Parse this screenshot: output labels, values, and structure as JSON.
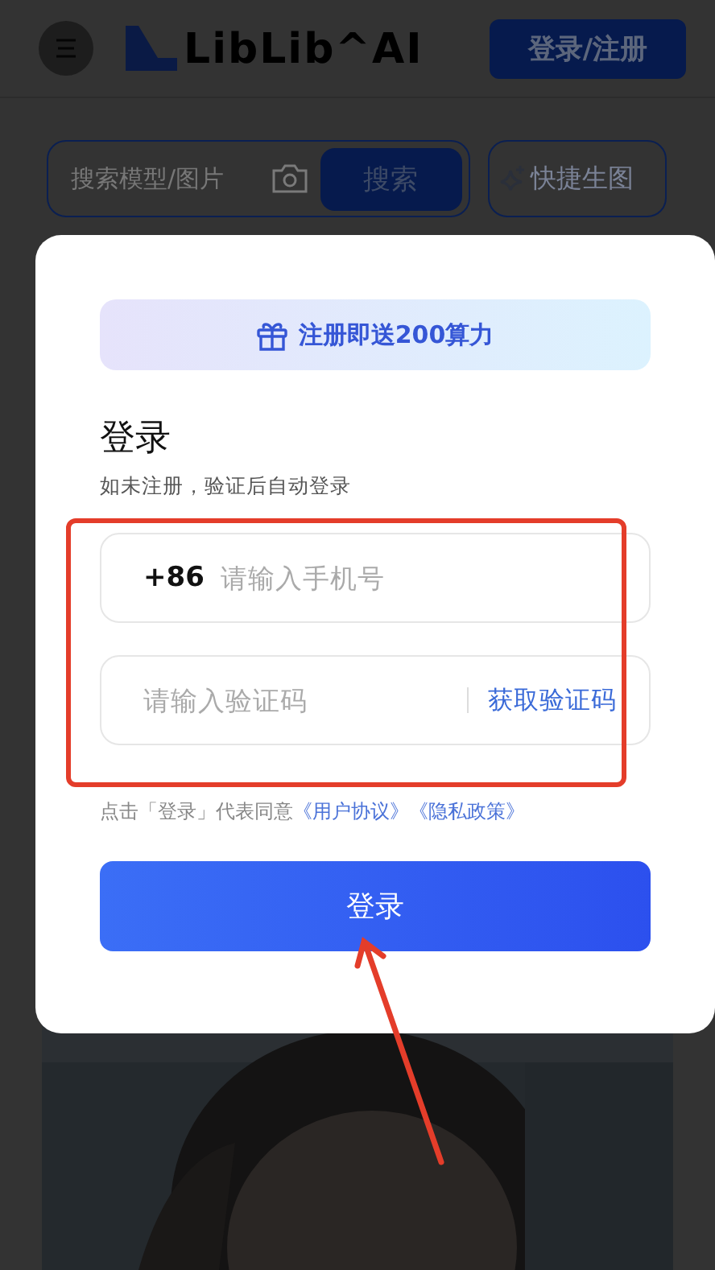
{
  "header": {
    "logo": "LibLib^AI",
    "login_button": "登录/注册"
  },
  "search": {
    "placeholder": "搜索模型/图片",
    "button": "搜索",
    "quick_button": "快捷生图"
  },
  "dialog": {
    "banner": "注册即送200算力",
    "title": "登录",
    "subtitle": "如未注册，验证后自动登录",
    "phone": {
      "prefix": "+86",
      "placeholder": "请输入手机号"
    },
    "code": {
      "placeholder": "请输入验证码",
      "action": "获取验证码"
    },
    "agreement": {
      "text": "点击「登录」代表同意",
      "links": [
        "《用户协议》",
        "《隐私政策》"
      ]
    },
    "submit": "登录"
  }
}
